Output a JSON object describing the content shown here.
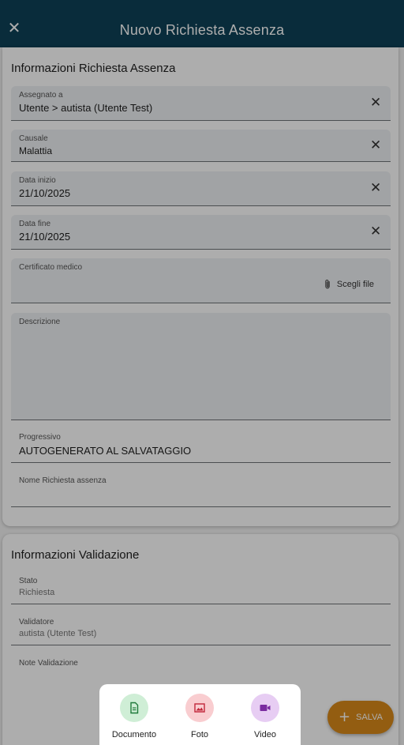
{
  "header": {
    "title": "Nuovo Richiesta Assenza",
    "close_icon": "close-icon"
  },
  "request_section": {
    "title": "Informazioni Richiesta Assenza",
    "assignee": {
      "label": "Assegnato a",
      "value": "Utente > autista (Utente Test)"
    },
    "reason": {
      "label": "Causale",
      "value": "Malattia"
    },
    "start_date": {
      "label": "Data inizio",
      "value": "21/10/2025"
    },
    "end_date": {
      "label": "Data fine",
      "value": "21/10/2025"
    },
    "certificate": {
      "label": "Certificato medico",
      "choose_label": "Scegli file",
      "icon": "paperclip-icon"
    },
    "description": {
      "label": "Descrizione",
      "value": ""
    },
    "progressive": {
      "label": "Progressivo",
      "value": "AUTOGENERATO AL SALVATAGGIO"
    },
    "request_name": {
      "label": "Nome Richiesta assenza",
      "value": ""
    }
  },
  "validation_section": {
    "title": "Informazioni Validazione",
    "status": {
      "label": "Stato",
      "value": "Richiesta"
    },
    "validator": {
      "label": "Validatore",
      "value": "autista (Utente Test)"
    },
    "notes": {
      "label": "Note Validazione",
      "value": ""
    }
  },
  "save_button": {
    "label": "SALVA",
    "icon": "plus-icon",
    "color": "#d98a1a"
  },
  "attachment_sheet": {
    "options": [
      {
        "label": "Documento",
        "icon": "document-icon",
        "bg": "#cfeed6",
        "fg": "#1f7a3a"
      },
      {
        "label": "Foto",
        "icon": "image-icon",
        "bg": "#f9cdd0",
        "fg": "#c2273a"
      },
      {
        "label": "Video",
        "icon": "video-icon",
        "bg": "#e7cdf3",
        "fg": "#7a2ba0"
      }
    ]
  },
  "colors": {
    "header_bg": "#0e4157",
    "field_bg": "#eef0f3"
  }
}
